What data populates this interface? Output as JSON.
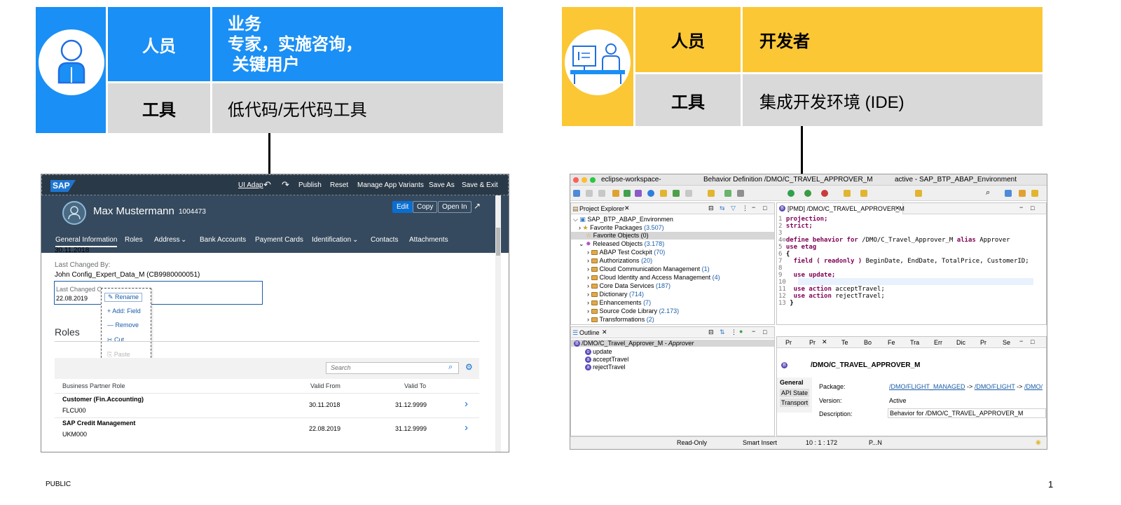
{
  "left_card": {
    "row1_label": "人员",
    "row1_value_line1": "业务",
    "row1_value_line2": "专家，实施咨询，",
    "row1_value_line3": " 关键用户",
    "row2_label": "工具",
    "row2_value": "低代码/无代码工具"
  },
  "right_card": {
    "row1_label": "人员",
    "row1_value": "开发者",
    "row2_label": "工具",
    "row2_value": "集成开发环境 (IDE)"
  },
  "sap_app": {
    "logo": "SAP",
    "menu": [
      "UI Adap",
      "Publish",
      "Reset",
      "Manage App Variants",
      "Save As",
      "Save & Exit"
    ],
    "user_name": "Max Mustermann",
    "user_id": "1004473",
    "actions": [
      "Edit",
      "Copy",
      "Open In"
    ],
    "tabs": [
      "General Information",
      "Roles",
      "Address",
      "Bank Accounts",
      "Payment Cards",
      "Identification",
      "Contacts",
      "Attachments"
    ],
    "date_top": "30.11.2018",
    "last_changed_by_label": "Last Changed By:",
    "last_changed_by_value": "John Config_Expert_Data_M (CB9980000051)",
    "last_changed_on_label": "Last Changed O",
    "last_changed_on_value": "22.08.2019",
    "context_menu": [
      "Rename",
      "Add: Field",
      "Remove",
      "Cut",
      "Paste"
    ],
    "roles_title": "Roles",
    "search_placeholder": "Search",
    "table_headers": [
      "Business Partner Role",
      "Valid From",
      "Valid To"
    ],
    "rows": [
      {
        "role": "Customer (Fin.Accounting)",
        "code": "FLCU00",
        "from": "30.11.2018",
        "to": "31.12.9999"
      },
      {
        "role": "SAP Credit Management",
        "code": "UKM000",
        "from": "22.08.2019",
        "to": "31.12.9999"
      }
    ]
  },
  "eclipse": {
    "title_left": "eclipse-workspace-",
    "title_mid": "Behavior Definition /DMO/C_TRAVEL_APPROVER_M",
    "title_right": "active - SAP_BTP_ABAP_Environment",
    "project_explorer_tab": "Project Explorer",
    "tree_root": "SAP_BTP_ABAP_Environmen",
    "fav_packages": "Favorite Packages",
    "fav_packages_count": "(3.507)",
    "fav_objects": "Favorite Objects (0)",
    "released": "Released Objects",
    "released_count": "(3.178)",
    "tree_items": [
      {
        "name": "ABAP Test Cockpit",
        "count": "(70)"
      },
      {
        "name": "Authorizations",
        "count": "(20)"
      },
      {
        "name": "Cloud Communication Management",
        "count": "(1)"
      },
      {
        "name": "Cloud Identity and Access Management",
        "count": "(4)"
      },
      {
        "name": "Core Data Services",
        "count": "(187)"
      },
      {
        "name": "Dictionary",
        "count": "(714)"
      },
      {
        "name": "Enhancements",
        "count": "(7)"
      },
      {
        "name": "Source Code Library",
        "count": "(2.173)"
      },
      {
        "name": "Transformations",
        "count": "(2)"
      }
    ],
    "editor_tab": "[PMD] /DMO/C_TRAVEL_APPROVER_M",
    "code_lines": [
      {
        "n": "1",
        "kw": "projection;",
        "rest": ""
      },
      {
        "n": "2",
        "kw": "strict;",
        "rest": ""
      },
      {
        "n": "3",
        "kw": "",
        "rest": ""
      },
      {
        "n": "4⊖",
        "kw": "define behavior for",
        "rest": " /DMO/C_Travel_Approver_M ",
        "kw2": "alias",
        "rest2": " Approver"
      },
      {
        "n": "5",
        "kw": "use etag",
        "rest": ""
      },
      {
        "n": "6",
        "kw": "",
        "rest": "{"
      },
      {
        "n": "7",
        "kw": "  field ( readonly )",
        "rest": " BeginDate, EndDate, TotalPrice, CustomerID;"
      },
      {
        "n": "8",
        "kw": "",
        "rest": ""
      },
      {
        "n": "9",
        "kw": "  use update;",
        "rest": ""
      },
      {
        "n": "10",
        "kw": "",
        "rest": ""
      },
      {
        "n": "11",
        "kw": "  use action",
        "rest": " acceptTravel;"
      },
      {
        "n": "12",
        "kw": "  use action",
        "rest": " rejectTravel;"
      },
      {
        "n": "13",
        "kw": "",
        "rest": "}"
      }
    ],
    "outline_tab": "Outline",
    "outline_root": "/DMO/C_Travel_Approver_M",
    "outline_root_suffix": " - Approver",
    "outline_items": [
      "update",
      "acceptTravel",
      "rejectTravel"
    ],
    "props_tabs": [
      "Pr",
      "Pr",
      "Te",
      "Bo",
      "Fe",
      "Tra",
      "Err",
      "Dic",
      "Pr",
      "Se"
    ],
    "props_title": "/DMO/C_TRAVEL_APPROVER_M",
    "props_side": [
      "General",
      "API State",
      "Transport"
    ],
    "package_label": "Package:",
    "package_value": [
      "/DMO/FLIGHT_MANAGED",
      "->",
      "/DMO/FLIGHT",
      "->",
      "/DMO/"
    ],
    "version_label": "Version:",
    "version_value": "Active",
    "description_label": "Description:",
    "description_value": "Behavior for /DMO/C_TRAVEL_APPROVER_M",
    "status": [
      "Read-Only",
      "Smart Insert",
      "10 : 1 : 172",
      "P...N"
    ]
  },
  "footer": {
    "classification": "PUBLIC",
    "page_number": "1"
  }
}
